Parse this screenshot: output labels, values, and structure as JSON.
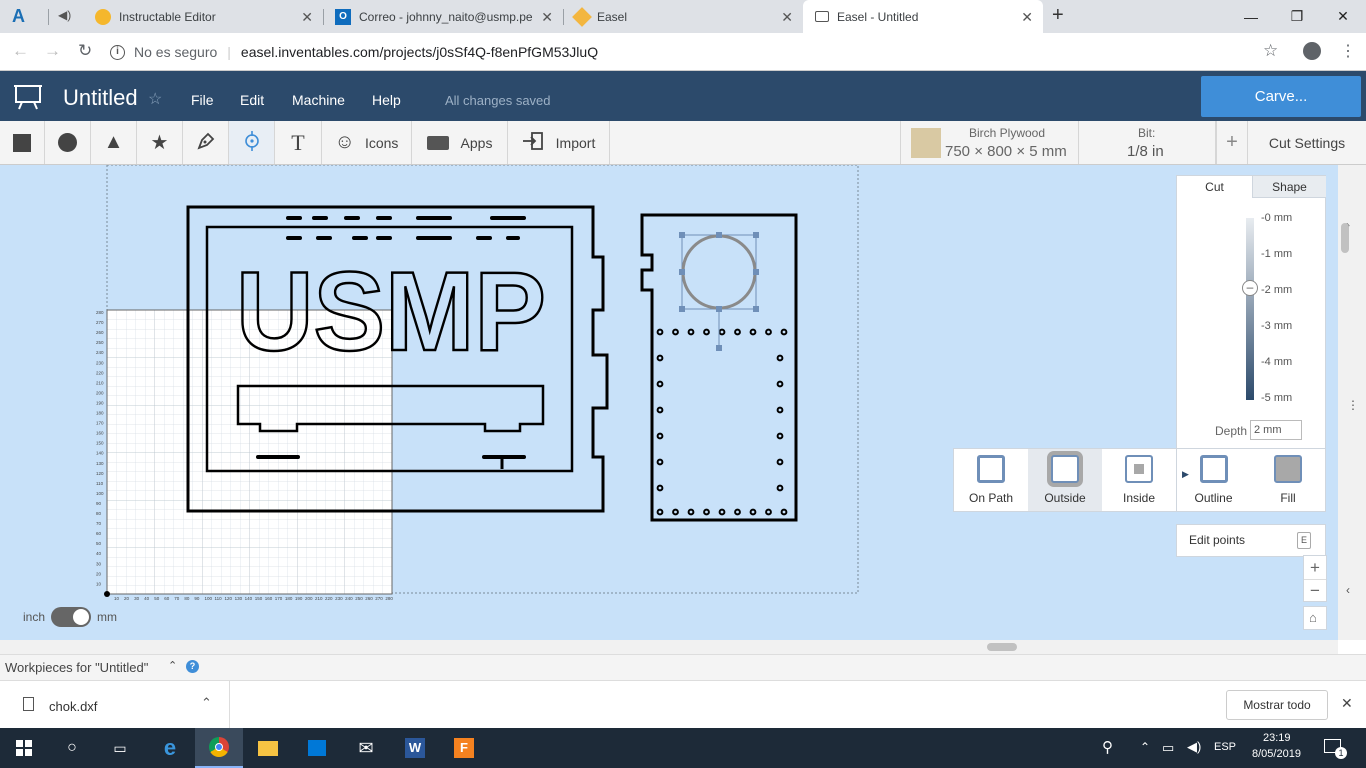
{
  "browser": {
    "tabs": [
      {
        "title": "",
        "icon": "autodesk-icon"
      },
      {
        "title": "Instructable Editor",
        "icon": "instructables-icon"
      },
      {
        "title": "Correo - johnny_naito@usmp.pe",
        "icon": "outlook-icon"
      },
      {
        "title": "Easel",
        "icon": "easel-icon"
      },
      {
        "title": "Easel - Untitled",
        "icon": "page-icon"
      }
    ],
    "security": "No es seguro",
    "url": "easel.inventables.com/projects/j0sSf4Q-f8enPfGM53JluQ"
  },
  "app": {
    "title": "Untitled",
    "menu": [
      "File",
      "Edit",
      "Machine",
      "Help"
    ],
    "status": "All changes saved",
    "carve_label": "Carve..."
  },
  "toolbar": {
    "icons_label": "Icons",
    "apps_label": "Apps",
    "import_label": "Import",
    "material_name": "Birch Plywood",
    "material_size": "750 × 800 × 5 mm",
    "bit_label": "Bit:",
    "bit_value": "1/8 in",
    "cut_settings_label": "Cut Settings"
  },
  "cut_panel": {
    "tabs": [
      "Cut",
      "Shape"
    ],
    "depth_ticks": [
      "-0 mm",
      "-1 mm",
      "-2 mm",
      "-3 mm",
      "-4 mm",
      "-5 mm"
    ],
    "depth_label": "Depth",
    "depth_value": "2 mm",
    "depth_fraction": 0.4,
    "cut_types": [
      "On Path",
      "Outside",
      "Inside",
      "Outline",
      "Fill"
    ],
    "selected_cut_type": "Outside",
    "edit_points_label": "Edit points",
    "edit_points_key": "E"
  },
  "canvas": {
    "logo_text": "USMP",
    "unit_left": "inch",
    "unit_right": "mm",
    "x_ticks": [
      "10",
      "20",
      "30",
      "40",
      "50",
      "60",
      "70",
      "80",
      "90",
      "100",
      "110",
      "120",
      "130",
      "140",
      "150",
      "160",
      "170",
      "180",
      "190",
      "200",
      "210",
      "220",
      "230",
      "240",
      "250",
      "260",
      "270",
      "280"
    ],
    "y_ticks": [
      "280",
      "270",
      "260",
      "250",
      "240",
      "230",
      "220",
      "210",
      "200",
      "190",
      "180",
      "170",
      "160",
      "150",
      "140",
      "130",
      "120",
      "110",
      "100",
      "90",
      "80",
      "70",
      "60",
      "50",
      "40",
      "30",
      "20",
      "10"
    ]
  },
  "workpieces": {
    "label": "Workpieces for \"Untitled\""
  },
  "downloads": {
    "file": "chok.dxf",
    "show_all": "Mostrar todo"
  },
  "taskbar": {
    "lang": "ESP",
    "time": "23:19",
    "date": "8/05/2019",
    "notif_count": "1"
  }
}
